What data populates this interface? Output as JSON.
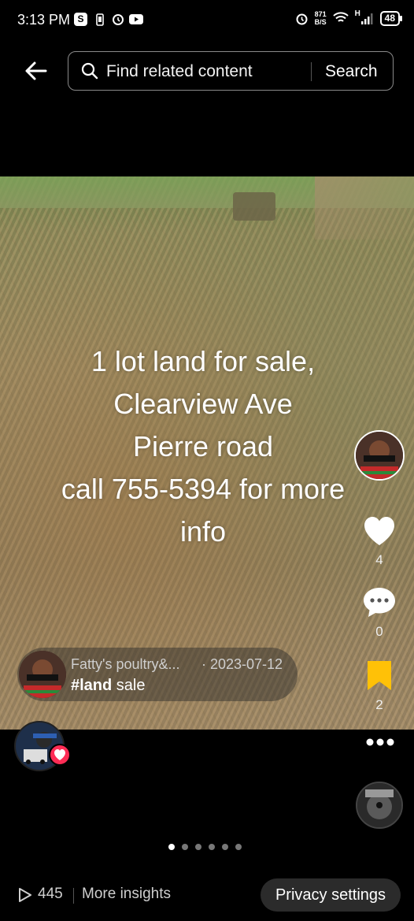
{
  "status_bar": {
    "time": "3:13 PM",
    "left_icons": [
      "s-icon",
      "phone-icon",
      "alarm-icon",
      "youtube-icon"
    ],
    "network_speed_value": "871",
    "network_speed_unit": "B/S",
    "signal_label": "H",
    "battery": "48"
  },
  "header": {
    "search_placeholder": "Find related content",
    "search_button": "Search"
  },
  "video": {
    "caption_lines": [
      "1 lot land for sale,",
      "Clearview Ave",
      "Pierre road",
      "call 755-5394 for more",
      "info"
    ]
  },
  "actions": {
    "likes": "4",
    "comments": "0",
    "saves": "2"
  },
  "post_info": {
    "author": "Fatty's poultry&...",
    "date": "· 2023-07-12",
    "hashtag": "#land",
    "description_rest": " sale"
  },
  "carousel": {
    "total": 6,
    "active_index": 0
  },
  "bottom": {
    "views": "445",
    "insights_label": "More insights",
    "privacy_label": "Privacy settings"
  },
  "colors": {
    "accent_red": "#fe2c55",
    "bookmark_yellow": "#ffc107",
    "background": "#000000"
  }
}
